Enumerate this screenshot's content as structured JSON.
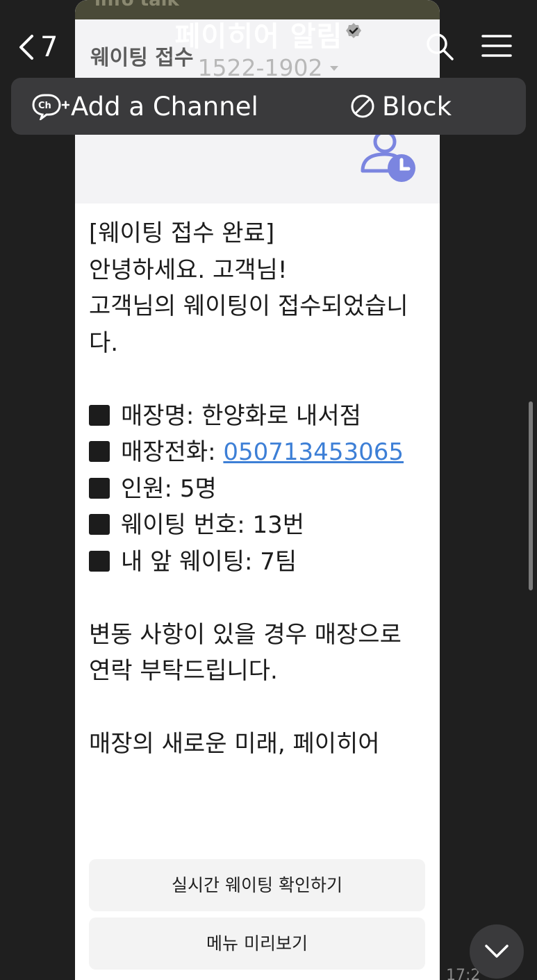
{
  "header": {
    "back_count": "7",
    "channel_name": "페이히어 알림",
    "phone": "1522-1902"
  },
  "action_bar": {
    "add_channel_label": "Add a Channel",
    "block_label": "Block"
  },
  "card": {
    "top_strip_text": "info talk",
    "header_label": "웨이팅 접수",
    "message": {
      "title": "[웨이팅 접수 완료]",
      "greeting": "안녕하세요. 고객님!",
      "intro": "고객님의 웨이팅이 접수되었습니다.",
      "store_name_label": "매장명: ",
      "store_name": "한양화로 내서점",
      "store_phone_label": "매장전화: ",
      "store_phone": "050713453065",
      "party_size_label": "인원: ",
      "party_size": "5명",
      "waiting_number_label": "웨이팅 번호: ",
      "waiting_number": "13번",
      "teams_ahead_label": "내 앞 웨이팅: ",
      "teams_ahead": "7팀",
      "notice": "변동 사항이 있을 경우 매장으로 연락 부탁드립니다.",
      "closing": "매장의 새로운 미래, 페이히어"
    },
    "buttons": {
      "realtime_waiting": "실시간 웨이팅 확인하기",
      "menu_preview": "메뉴 미리보기"
    }
  },
  "timestamp": "17:2",
  "colors": {
    "background": "#1f1f1f",
    "card": "#ffffff",
    "link": "#3d7fd6",
    "icon_accent": "#7b85e0"
  }
}
